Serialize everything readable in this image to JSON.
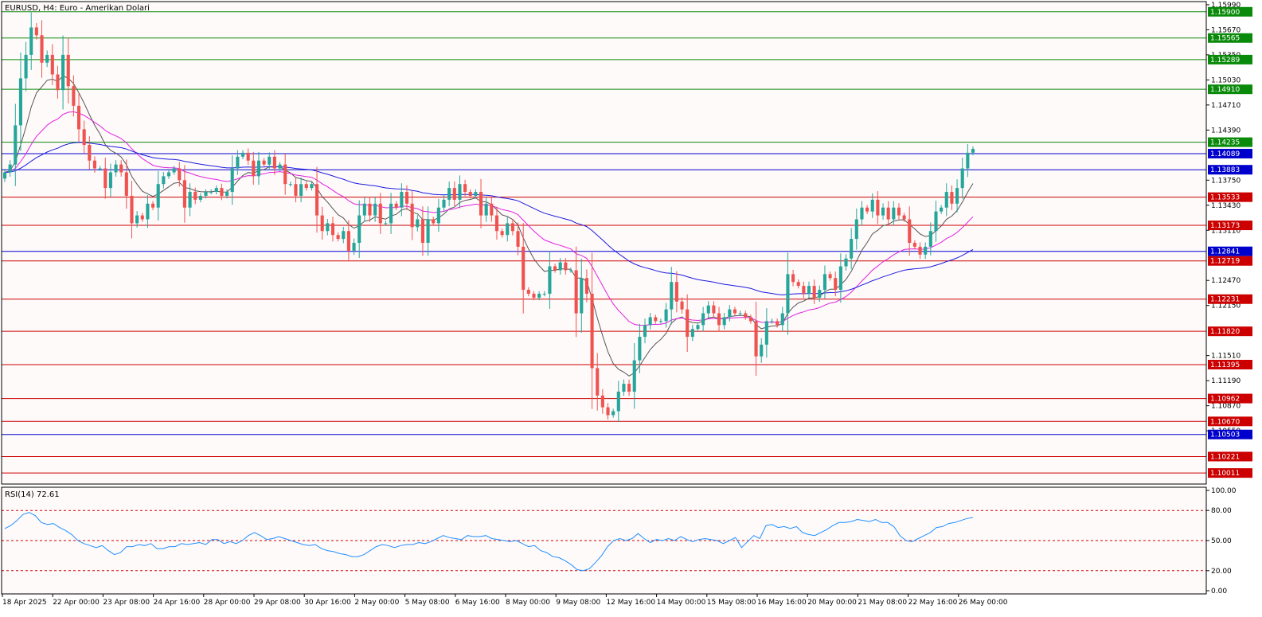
{
  "header": {
    "symbol_text": "EURUSD, H4:  Euro - Amerikan Dolari",
    "rsi_text": "RSI(14) 72.61"
  },
  "colors": {
    "bull": "#26a69a",
    "bear": "#ef5350",
    "support": "#cc0000",
    "resistance": "#0a8a0a",
    "pivot": "#0000cc",
    "ma_fast": "#555555",
    "ma_mid": "#e020e0",
    "ma_slow": "#1a1ae0",
    "rsi": "#1e90ff",
    "grid_dash": "#cc0000",
    "background": "#fffafa"
  },
  "chart_data": [
    {
      "type": "candlestick",
      "symbol": "EURUSD",
      "timeframe": "H4",
      "ylim": [
        1.0987,
        1.1603
      ],
      "y_ticks": [
        "1.15990",
        "1.15670",
        "1.15350",
        "1.15030",
        "1.14710",
        "1.14390",
        "1.13750",
        "1.13430",
        "1.13110",
        "1.12470",
        "1.12150",
        "1.11510",
        "1.11190",
        "1.10870",
        "1.10550"
      ],
      "x_ticks": [
        "18 Apr 2025",
        "22 Apr 00:00",
        "23 Apr 08:00",
        "24 Apr 16:00",
        "28 Apr 00:00",
        "29 Apr 08:00",
        "30 Apr 16:00",
        "2 May 00:00",
        "5 May 08:00",
        "6 May 16:00",
        "8 May 00:00",
        "9 May 08:00",
        "12 May 16:00",
        "14 May 00:00",
        "15 May 08:00",
        "16 May 16:00",
        "20 May 00:00",
        "21 May 08:00",
        "22 May 16:00",
        "26 May 00:00"
      ],
      "levels": [
        {
          "value": 1.159,
          "label": "1.15900",
          "kind": "resistance"
        },
        {
          "value": 1.15565,
          "label": "1.15565",
          "kind": "resistance"
        },
        {
          "value": 1.15289,
          "label": "1.15289",
          "kind": "resistance"
        },
        {
          "value": 1.1491,
          "label": "1.14910",
          "kind": "resistance"
        },
        {
          "value": 1.14235,
          "label": "1.14235",
          "kind": "resistance"
        },
        {
          "value": 1.14089,
          "label": "1.14089",
          "kind": "pivot"
        },
        {
          "value": 1.13883,
          "label": "1.13883",
          "kind": "pivot"
        },
        {
          "value": 1.13533,
          "label": "1.13533",
          "kind": "support"
        },
        {
          "value": 1.13173,
          "label": "1.13173",
          "kind": "support"
        },
        {
          "value": 1.12841,
          "label": "1.12841",
          "kind": "pivot"
        },
        {
          "value": 1.12719,
          "label": "1.12719",
          "kind": "support"
        },
        {
          "value": 1.12231,
          "label": "1.12231",
          "kind": "support"
        },
        {
          "value": 1.1182,
          "label": "1.11820",
          "kind": "support"
        },
        {
          "value": 1.11395,
          "label": "1.11395",
          "kind": "support"
        },
        {
          "value": 1.10962,
          "label": "1.10962",
          "kind": "support"
        },
        {
          "value": 1.1067,
          "label": "1.10670",
          "kind": "support"
        },
        {
          "value": 1.10503,
          "label": "1.10503",
          "kind": "pivot"
        },
        {
          "value": 1.10221,
          "label": "1.10221",
          "kind": "support"
        },
        {
          "value": 1.10011,
          "label": "1.10011",
          "kind": "support"
        }
      ],
      "close_series": [
        1.1385,
        1.1395,
        1.1445,
        1.1505,
        1.1535,
        1.157,
        1.156,
        1.1525,
        1.1535,
        1.151,
        1.149,
        1.1535,
        1.1495,
        1.147,
        1.144,
        1.142,
        1.14,
        1.139,
        1.139,
        1.1365,
        1.1385,
        1.1395,
        1.1385,
        1.1355,
        1.132,
        1.133,
        1.1325,
        1.1345,
        1.134,
        1.137,
        1.138,
        1.1385,
        1.139,
        1.1375,
        1.134,
        1.136,
        1.135,
        1.1355,
        1.136,
        1.136,
        1.1365,
        1.1355,
        1.136,
        1.139,
        1.1405,
        1.141,
        1.14,
        1.138,
        1.14,
        1.1395,
        1.1405,
        1.139,
        1.1395,
        1.137,
        1.137,
        1.1355,
        1.137,
        1.1365,
        1.137,
        1.133,
        1.131,
        1.132,
        1.1305,
        1.13,
        1.131,
        1.1285,
        1.1295,
        1.133,
        1.1345,
        1.133,
        1.1345,
        1.132,
        1.132,
        1.1345,
        1.134,
        1.136,
        1.1345,
        1.1315,
        1.1325,
        1.1295,
        1.1325,
        1.132,
        1.134,
        1.135,
        1.1365,
        1.135,
        1.137,
        1.136,
        1.1355,
        1.136,
        1.133,
        1.1345,
        1.133,
        1.131,
        1.1305,
        1.132,
        1.131,
        1.129,
        1.1235,
        1.123,
        1.1225,
        1.123,
        1.123,
        1.1265,
        1.126,
        1.127,
        1.126,
        1.126,
        1.1205,
        1.125,
        1.123,
        1.1135,
        1.11,
        1.1085,
        1.1075,
        1.108,
        1.1105,
        1.1115,
        1.1105,
        1.1145,
        1.1175,
        1.119,
        1.12,
        1.1195,
        1.1195,
        1.121,
        1.1245,
        1.122,
        1.121,
        1.1175,
        1.1185,
        1.119,
        1.1205,
        1.1215,
        1.1205,
        1.119,
        1.12,
        1.121,
        1.1205,
        1.1205,
        1.12,
        1.1195,
        1.115,
        1.1165,
        1.1195,
        1.1195,
        1.119,
        1.1205,
        1.1255,
        1.1245,
        1.124,
        1.123,
        1.124,
        1.1225,
        1.1235,
        1.1255,
        1.125,
        1.1235,
        1.1265,
        1.1275,
        1.13,
        1.1325,
        1.134,
        1.1335,
        1.135,
        1.133,
        1.134,
        1.1325,
        1.134,
        1.133,
        1.1325,
        1.1295,
        1.129,
        1.128,
        1.129,
        1.131,
        1.1335,
        1.134,
        1.136,
        1.1345,
        1.1365,
        1.139,
        1.141,
        1.1415
      ]
    },
    {
      "type": "line",
      "title": "RSI(14) 72.61",
      "ylim": [
        0,
        100
      ],
      "y_ticks": [
        "100.00",
        "80.00",
        "50.00",
        "20.00",
        "0.00"
      ],
      "levels": [
        80,
        50,
        20
      ],
      "values": [
        62,
        65,
        70,
        76,
        78,
        75,
        68,
        66,
        67,
        63,
        60,
        56,
        50,
        47,
        45,
        43,
        45,
        40,
        36,
        38,
        44,
        44,
        46,
        45,
        47,
        42,
        42,
        44,
        44,
        47,
        46,
        47,
        48,
        46,
        51,
        51,
        47,
        49,
        47,
        50,
        55,
        58,
        55,
        51,
        52,
        54,
        52,
        50,
        48,
        46,
        45,
        46,
        42,
        40,
        39,
        37,
        36,
        34,
        34,
        36,
        40,
        44,
        46,
        45,
        43,
        45,
        46,
        46,
        48,
        47,
        49,
        52,
        55,
        53,
        52,
        51,
        55,
        54,
        54,
        55,
        52,
        51,
        50,
        49,
        50,
        47,
        44,
        45,
        40,
        38,
        34,
        33,
        30,
        26,
        21,
        20,
        22,
        28,
        35,
        44,
        50,
        52,
        50,
        52,
        57,
        52,
        48,
        51,
        50,
        52,
        50,
        54,
        51,
        49,
        51,
        52,
        51,
        50,
        47,
        50,
        53,
        43,
        49,
        55,
        52,
        65,
        66,
        63,
        64,
        62,
        64,
        58,
        56,
        55,
        58,
        61,
        65,
        68,
        68,
        69,
        71,
        70,
        69,
        71,
        68,
        68,
        64,
        55,
        50,
        49,
        52,
        55,
        58,
        63,
        64,
        67,
        68,
        70,
        72,
        73
      ]
    }
  ]
}
